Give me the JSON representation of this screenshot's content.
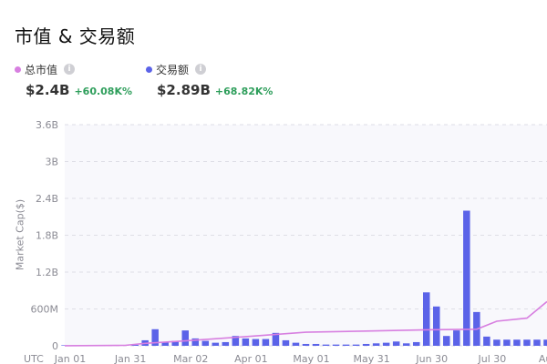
{
  "title": "市值 & 交易额",
  "metrics": [
    {
      "label": "总市值",
      "value": "$2.4B",
      "change": "+60.08K%",
      "color": "#d77fe0"
    },
    {
      "label": "交易额",
      "value": "$2.89B",
      "change": "+68.82K%",
      "color": "#5b63e8"
    }
  ],
  "info_glyph": "i",
  "chart_data": {
    "type": "bar",
    "title": "",
    "ylabel": "Market Cap($)",
    "xlabel": "",
    "timezone_label": "UTC",
    "ylim": [
      0,
      3.6
    ],
    "y_unit": "B",
    "y_ticks": [
      {
        "value": 0,
        "label": "0"
      },
      {
        "value": 0.6,
        "label": "600M"
      },
      {
        "value": 1.2,
        "label": "1.2B"
      },
      {
        "value": 1.8,
        "label": "1.8B"
      },
      {
        "value": 2.4,
        "label": "2.4B"
      },
      {
        "value": 3.0,
        "label": "3B"
      },
      {
        "value": 3.6,
        "label": "3.6B"
      }
    ],
    "x_ticks": [
      {
        "value": 0,
        "label": "Jan 01"
      },
      {
        "value": 30,
        "label": "Jan 31"
      },
      {
        "value": 60,
        "label": "Mar 02"
      },
      {
        "value": 90,
        "label": "Apr 01"
      },
      {
        "value": 120,
        "label": "May 01"
      },
      {
        "value": 150,
        "label": "May 31"
      },
      {
        "value": 180,
        "label": "Jun 30"
      },
      {
        "value": 210,
        "label": "Jul 30"
      },
      {
        "value": 238,
        "label": "Aug"
      }
    ],
    "grid": true,
    "series": [
      {
        "name": "交易额",
        "kind": "bar",
        "color": "#5b63e8",
        "x": [
          0,
          5,
          10,
          15,
          20,
          25,
          30,
          35,
          40,
          45,
          50,
          55,
          60,
          65,
          70,
          75,
          80,
          85,
          90,
          95,
          100,
          105,
          110,
          115,
          120,
          125,
          130,
          135,
          140,
          145,
          150,
          155,
          160,
          165,
          170,
          175,
          180,
          185,
          190,
          195,
          200,
          205,
          210,
          215,
          220,
          225,
          230,
          235,
          240
        ],
        "values": [
          0.003,
          0.004,
          0.005,
          0.006,
          0.007,
          0.01,
          0.012,
          0.015,
          0.09,
          0.27,
          0.06,
          0.08,
          0.25,
          0.12,
          0.08,
          0.05,
          0.06,
          0.16,
          0.12,
          0.11,
          0.11,
          0.21,
          0.09,
          0.05,
          0.03,
          0.03,
          0.02,
          0.02,
          0.02,
          0.02,
          0.03,
          0.04,
          0.05,
          0.07,
          0.04,
          0.06,
          0.87,
          0.64,
          0.16,
          0.25,
          2.2,
          0.55,
          0.15,
          0.1,
          0.1,
          0.1,
          0.1,
          0.1,
          0.1
        ]
      },
      {
        "name": "总市值",
        "kind": "line",
        "color": "#d77fe0",
        "x": [
          0,
          30,
          40,
          60,
          90,
          120,
          150,
          180,
          205,
          215,
          230,
          240
        ],
        "values": [
          0.001,
          0.008,
          0.04,
          0.08,
          0.15,
          0.22,
          0.24,
          0.26,
          0.27,
          0.4,
          0.45,
          0.72
        ]
      }
    ]
  }
}
